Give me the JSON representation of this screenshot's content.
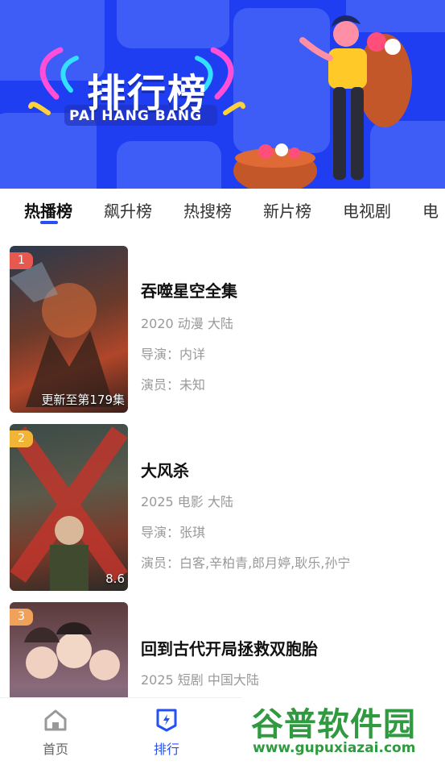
{
  "banner": {
    "title": "排行榜",
    "subtitle": "PAI HANG BANG"
  },
  "tabs": [
    {
      "label": "热播榜",
      "active": true
    },
    {
      "label": "飙升榜",
      "active": false
    },
    {
      "label": "热搜榜",
      "active": false
    },
    {
      "label": "新片榜",
      "active": false
    },
    {
      "label": "电视剧",
      "active": false
    },
    {
      "label": "电",
      "active": false
    }
  ],
  "items": [
    {
      "rank": "1",
      "rank_color": "#e7584f",
      "poster_note": "更新至第179集",
      "title": "吞噬星空全集",
      "meta": "2020 动漫 大陆",
      "director": "导演：内详",
      "actors": "演员：未知"
    },
    {
      "rank": "2",
      "rank_color": "#f2b437",
      "poster_note": "8.6",
      "title": "大风杀",
      "meta": "2025 电影 大陆",
      "director": "导演：张琪",
      "actors": "演员：白客,辛柏青,郎月婷,耿乐,孙宁"
    },
    {
      "rank": "3",
      "rank_color": "#f0a25a",
      "poster_note": "",
      "title": "回到古代开局拯救双胞胎",
      "meta": "2025 短剧 中国大陆",
      "director": "",
      "actors": ""
    }
  ],
  "bottom_nav": [
    {
      "label": "首页",
      "icon": "home-icon",
      "active": false
    },
    {
      "label": "排行",
      "icon": "ranking-icon",
      "active": true
    }
  ],
  "watermark": {
    "text": "谷普软件园",
    "url": "www.gupuxiazai.com"
  },
  "colors": {
    "accent": "#2450f5",
    "banner": "#1f3ef2"
  }
}
